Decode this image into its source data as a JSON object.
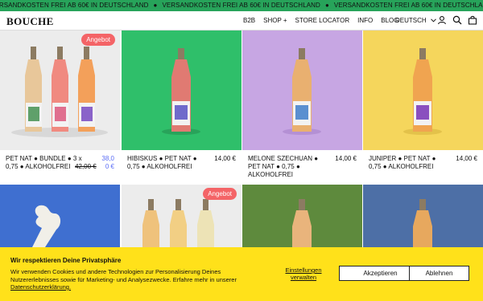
{
  "ticker": {
    "message": "VERSANDKOSTEN FREI AB 60€ IN DEUTSCHLAND"
  },
  "header": {
    "logo": "BOUCHE",
    "nav": [
      "B2B",
      "SHOP +",
      "STORE LOCATOR",
      "INFO",
      "BLOG"
    ],
    "language": "DEUTSCH",
    "icons": [
      "user-icon",
      "search-icon",
      "bag-icon"
    ]
  },
  "products": [
    {
      "name": "PET NAT ● BUNDLE ● 3 x 0,75 ● ALKOHOLFREI",
      "old_price": "42,00 €",
      "price": "38,00 €",
      "badge": "Angebot",
      "bg": "#ececec"
    },
    {
      "name": "HIBISKUS ● PET NAT ● 0,75 ● ALKOHOLFREI",
      "price": "14,00 €",
      "bg": "#2fbf6a"
    },
    {
      "name": "MELONE SZECHUAN ● PET NAT ● 0,75 ● ALKOHOLFREI",
      "price": "14,00 €",
      "bg": "#c7a6e3"
    },
    {
      "name": "JUNIPER ● PET NAT ● 0,75 ● ALKOHOLFREI",
      "price": "14,00 €",
      "bg": "#f5d65c"
    },
    {
      "bg": "#3f6fd0"
    },
    {
      "badge": "Angebot",
      "bg": "#ececec"
    },
    {
      "bg": "#5e8a3d"
    },
    {
      "bg": "#4d6fa6"
    }
  ],
  "cookie": {
    "title": "Wir respektieren Deine Privatsphäre",
    "text": "Wir verwenden Cookies und andere Technologien zur Personalisierung Deines Nutzererlebnisses sowie für Marketing- und Analysezwecke. Erfahre mehr in unserer",
    "link": "Datenschutzerklärung.",
    "settings": "Einstellungen verwalten",
    "accept": "Akzeptieren",
    "decline": "Ablehnen"
  }
}
